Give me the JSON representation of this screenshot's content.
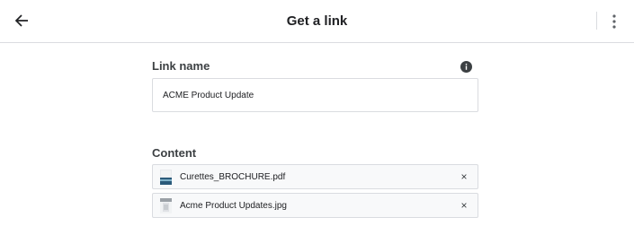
{
  "header": {
    "title": "Get a link",
    "back_icon": "arrow-left-icon",
    "more_icon": "more-vertical-icon"
  },
  "link_name": {
    "label": "Link name",
    "value": "ACME Product Update",
    "info_icon": "info-icon"
  },
  "content": {
    "label": "Content",
    "files": [
      {
        "name": "Curettes_BROCHURE.pdf",
        "thumb_icon": "pdf-thumbnail-icon",
        "remove_icon": "close-icon",
        "remove_label": "×"
      },
      {
        "name": "Acme Product Updates.jpg",
        "thumb_icon": "image-thumbnail-icon",
        "remove_icon": "close-icon",
        "remove_label": "×"
      }
    ]
  },
  "colors": {
    "text": "#202124",
    "border": "#dadce0",
    "row_bg": "#f8f9fa"
  }
}
